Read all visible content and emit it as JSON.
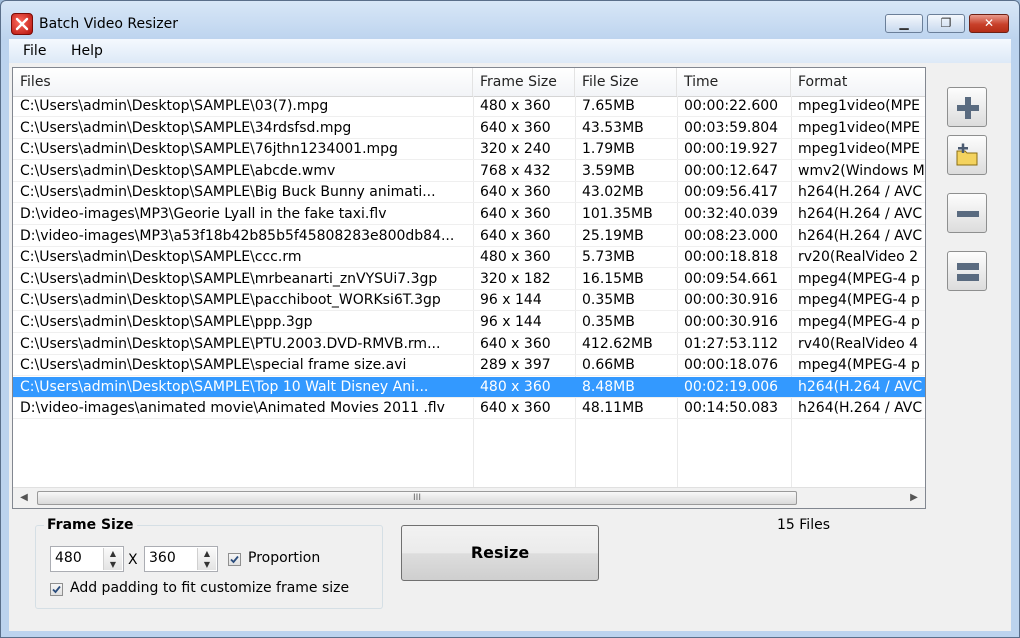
{
  "window": {
    "title": "Batch Video Resizer",
    "min_glyph": "▁",
    "max_glyph": "❐",
    "close_glyph": "✕"
  },
  "menu": [
    {
      "label": "File"
    },
    {
      "label": "Help"
    }
  ],
  "table": {
    "columns": [
      "Files",
      "Frame Size",
      "File Size",
      "Time",
      "Format"
    ],
    "rows": [
      [
        "C:\\Users\\admin\\Desktop\\SAMPLE\\03(7).mpg",
        "480 x 360",
        "7.65MB",
        "00:00:22.600",
        "mpeg1video(MPE"
      ],
      [
        "C:\\Users\\admin\\Desktop\\SAMPLE\\34rdsfsd.mpg",
        "640 x 360",
        "43.53MB",
        "00:03:59.804",
        "mpeg1video(MPE"
      ],
      [
        "C:\\Users\\admin\\Desktop\\SAMPLE\\76jthn1234001.mpg",
        "320 x 240",
        "1.79MB",
        "00:00:19.927",
        "mpeg1video(MPE"
      ],
      [
        "C:\\Users\\admin\\Desktop\\SAMPLE\\abcde.wmv",
        "768 x 432",
        "3.59MB",
        "00:00:12.647",
        "wmv2(Windows M"
      ],
      [
        "C:\\Users\\admin\\Desktop\\SAMPLE\\Big Buck Bunny animati...",
        "640 x 360",
        "43.02MB",
        "00:09:56.417",
        "h264(H.264 / AVC"
      ],
      [
        "D:\\video-images\\MP3\\Georie Lyall in the fake taxi.flv",
        "640 x 360",
        "101.35MB",
        "00:32:40.039",
        "h264(H.264 / AVC"
      ],
      [
        "D:\\video-images\\MP3\\a53f18b42b85b5f45808283e800db84...",
        "640 x 360",
        "25.19MB",
        "00:08:23.000",
        "h264(H.264 / AVC"
      ],
      [
        "C:\\Users\\admin\\Desktop\\SAMPLE\\ccc.rm",
        "480 x 360",
        "5.73MB",
        "00:00:18.818",
        "rv20(RealVideo 2"
      ],
      [
        "C:\\Users\\admin\\Desktop\\SAMPLE\\mrbeanarti_znVYSUi7.3gp",
        "320 x 182",
        "16.15MB",
        "00:09:54.661",
        "mpeg4(MPEG-4 p"
      ],
      [
        "C:\\Users\\admin\\Desktop\\SAMPLE\\pacchiboot_WORKsi6T.3gp",
        "96 x 144",
        "0.35MB",
        "00:00:30.916",
        "mpeg4(MPEG-4 p"
      ],
      [
        "C:\\Users\\admin\\Desktop\\SAMPLE\\ppp.3gp",
        "96 x 144",
        "0.35MB",
        "00:00:30.916",
        "mpeg4(MPEG-4 p"
      ],
      [
        "C:\\Users\\admin\\Desktop\\SAMPLE\\PTU.2003.DVD-RMVB.rm...",
        "640 x 360",
        "412.62MB",
        "01:27:53.112",
        "rv40(RealVideo 4"
      ],
      [
        "C:\\Users\\admin\\Desktop\\SAMPLE\\special frame size.avi",
        "289 x 397",
        "0.66MB",
        "00:00:18.076",
        "mpeg4(MPEG-4 p"
      ],
      [
        "C:\\Users\\admin\\Desktop\\SAMPLE\\Top 10 Walt Disney Ani...",
        "480 x 360",
        "8.48MB",
        "00:02:19.006",
        "h264(H.264 / AVC"
      ],
      [
        "D:\\video-images\\animated movie\\Animated Movies 2011 .flv",
        "640 x 360",
        "48.11MB",
        "00:14:50.083",
        "h264(H.264 / AVC"
      ]
    ],
    "selected_index": 13,
    "scroll_left": "◀",
    "scroll_right": "▶",
    "scroll_grip": "III"
  },
  "side_buttons": [
    {
      "name": "add-file-button",
      "icon": "plus-icon"
    },
    {
      "name": "add-folder-button",
      "icon": "folder-add-icon"
    },
    {
      "name": "remove-file-button",
      "icon": "minus-icon"
    },
    {
      "name": "clear-list-button",
      "icon": "clear-all-icon"
    }
  ],
  "frame_size": {
    "title": "Frame Size",
    "width": "480",
    "height": "360",
    "x_label": "X",
    "proportion_label": "Proportion",
    "proportion_checked": true,
    "padding_label": "Add padding to fit customize frame size",
    "padding_checked": true,
    "spin_up": "▲",
    "spin_down": "▼"
  },
  "resize_label": "Resize",
  "file_count": "15 Files",
  "colors": {
    "selection": "#3399ff",
    "accent_icon": "#5a6b80"
  }
}
